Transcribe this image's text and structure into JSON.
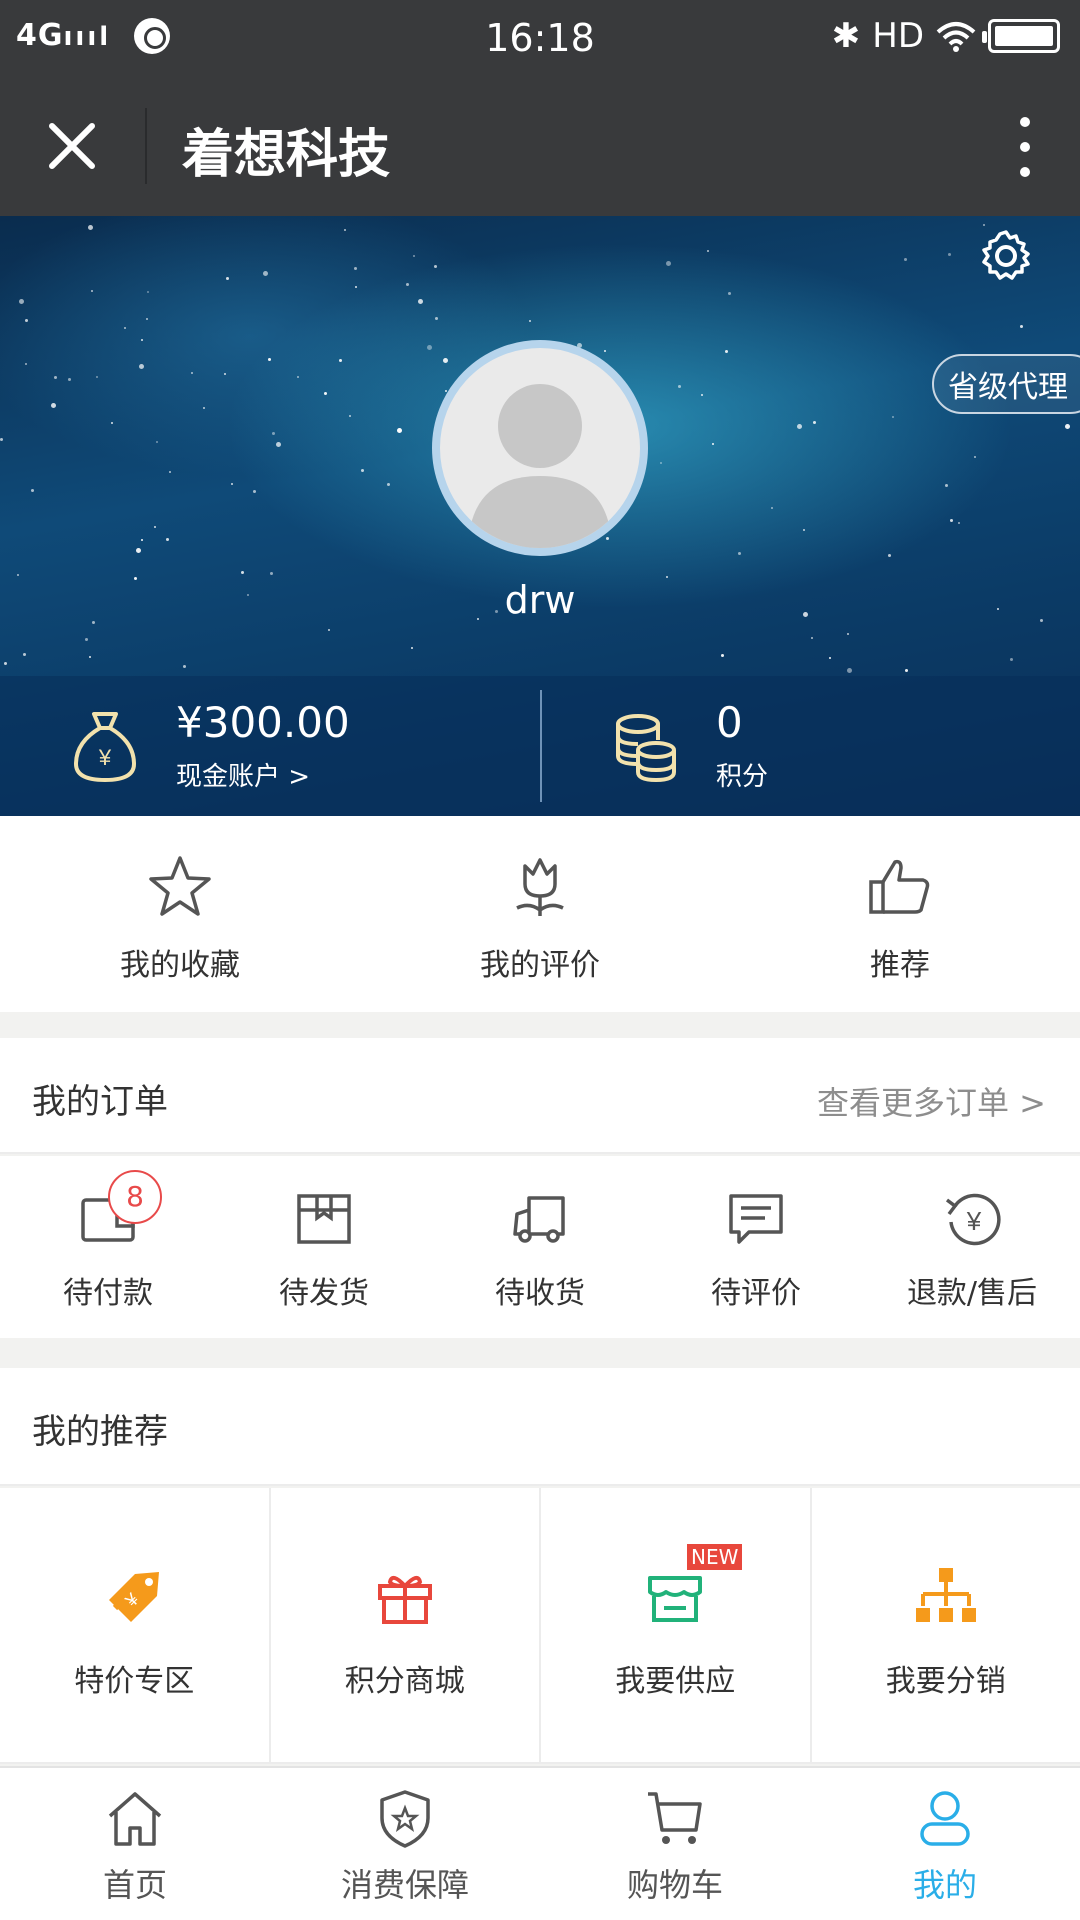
{
  "status_bar": {
    "signal": "4G",
    "time": "16:18",
    "hd": "HD"
  },
  "titlebar": {
    "title": "着想科技"
  },
  "profile": {
    "badge": "省级代理",
    "username": "drw",
    "cash": {
      "value": "¥300.00",
      "label": "现金账户 >"
    },
    "points": {
      "value": "0",
      "label": "积分"
    }
  },
  "shortcuts": [
    {
      "label": "我的收藏",
      "icon": "star-icon"
    },
    {
      "label": "我的评价",
      "icon": "flower-icon"
    },
    {
      "label": "推荐",
      "icon": "thumbs-up-icon"
    }
  ],
  "orders": {
    "title": "我的订单",
    "more": "查看更多订单 >",
    "items": [
      {
        "label": "待付款",
        "badge": "8",
        "icon": "wallet-icon"
      },
      {
        "label": "待发货",
        "icon": "box-icon"
      },
      {
        "label": "待收货",
        "icon": "truck-icon"
      },
      {
        "label": "待评价",
        "icon": "comment-icon"
      },
      {
        "label": "退款/售后",
        "icon": "refund-icon"
      }
    ]
  },
  "recommend": {
    "title": "我的推荐",
    "items": [
      {
        "label": "特价专区",
        "icon": "price-tag-icon",
        "color": "#f59a1b"
      },
      {
        "label": "积分商城",
        "icon": "gift-icon",
        "color": "#e8473c"
      },
      {
        "label": "我要供应",
        "icon": "store-icon",
        "color": "#21b27a",
        "tag": "NEW"
      },
      {
        "label": "我要分销",
        "icon": "hierarchy-icon",
        "color": "#f59a1b"
      }
    ]
  },
  "tabbar": [
    {
      "label": "首页",
      "icon": "home-icon"
    },
    {
      "label": "消费保障",
      "icon": "shield-icon"
    },
    {
      "label": "购物车",
      "icon": "cart-icon"
    },
    {
      "label": "我的",
      "icon": "user-icon",
      "active": true
    }
  ],
  "colors": {
    "accent": "#2aaee8",
    "badge_red": "#e84a4a",
    "header": "#393a3c"
  }
}
